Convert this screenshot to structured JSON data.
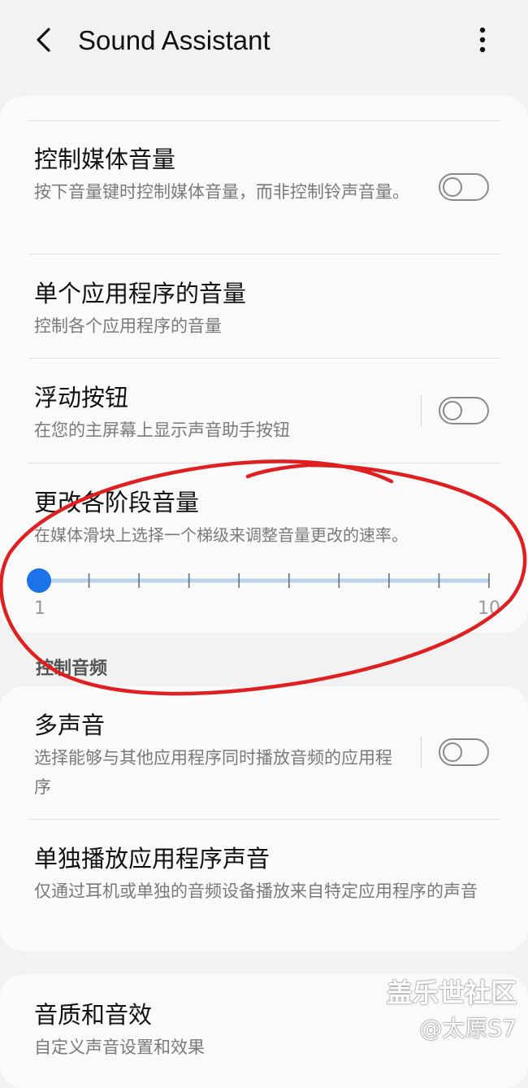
{
  "header": {
    "title": "Sound Assistant"
  },
  "card1": {
    "rows": [
      {
        "title": "控制媒体音量",
        "subtitle": "按下音量键时控制媒体音量，而非控制铃声音量。"
      },
      {
        "title": "单个应用程序的音量",
        "subtitle": "控制各个应用程序的音量"
      },
      {
        "title": "浮动按钮",
        "subtitle": "在您的主屏幕上显示声音助手按钮"
      },
      {
        "title": "更改各阶段音量",
        "subtitle": "在媒体滑块上选择一个梯级来调整音量更改的速率。"
      }
    ],
    "slider": {
      "min_label": "1",
      "max_label": "10",
      "min": 1,
      "max": 10,
      "value": 1,
      "accent": "#1a73e8",
      "track": "#b9d5ee"
    }
  },
  "section": {
    "label": "控制音频"
  },
  "card2": {
    "rows": [
      {
        "title": "多声音",
        "subtitle": "选择能够与其他应用程序同时播放音频的应用程序"
      },
      {
        "title": "单独播放应用程序声音",
        "subtitle": "仅通过耳机或单独的音频设备播放来自特定应用程序的声音"
      }
    ]
  },
  "card3": {
    "rows": [
      {
        "title": "音质和音效",
        "subtitle": "自定义声音设置和效果"
      }
    ]
  },
  "watermark": {
    "line1": "盖乐世社区",
    "line2": "@太原S7"
  },
  "colors": {
    "annotation": "#e02020"
  }
}
